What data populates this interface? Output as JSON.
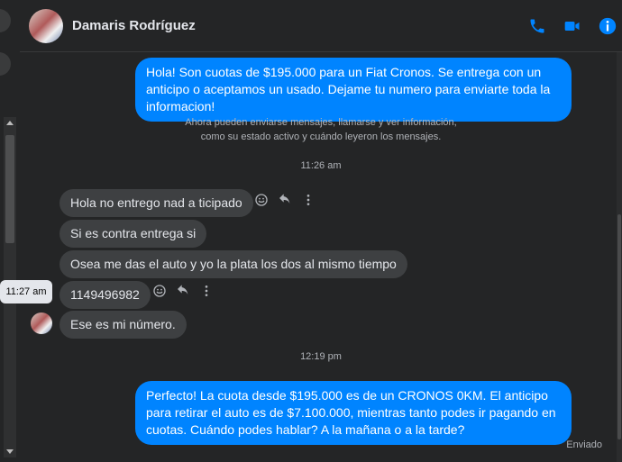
{
  "contact": {
    "name": "Damaris Rodríguez"
  },
  "header": {
    "icons": [
      "phone-icon",
      "video-camera-icon",
      "info-icon"
    ],
    "accent": "#0084ff"
  },
  "messages": {
    "out_1": "Hola! Son cuotas de $195.000 para un Fiat Cronos. Se entrega con un anticipo o aceptamos un usado. Dejame tu numero para enviarte toda la informacion!",
    "system_notice": "Ahora pueden enviarse mensajes, llamarse y ver información, como su estado activo y cuándo leyeron los mensajes.",
    "time_1": "11:26 am",
    "in_1": "Hola no entrego nad a ticipado",
    "in_2": "Si es contra entrega si",
    "in_3": "Osea me das el auto y yo la plata los dos al mismo tiempo",
    "in_4": "1149496982",
    "hover_time": "11:27 am",
    "in_5": "Ese es mi número.",
    "time_2": "12:19 pm",
    "out_2": "Perfecto! La cuota desde $195.000 es de un CRONOS 0KM. El anticipo para retirar el auto es de $7.100.000, mientras tanto podes ir pagando en cuotas. Cuándo podes hablar? A la mañana o a la tarde?",
    "status": "Enviado"
  },
  "colors": {
    "outgoing_bubble": "#0084ff",
    "incoming_bubble": "#3e4042",
    "background": "#242526"
  }
}
